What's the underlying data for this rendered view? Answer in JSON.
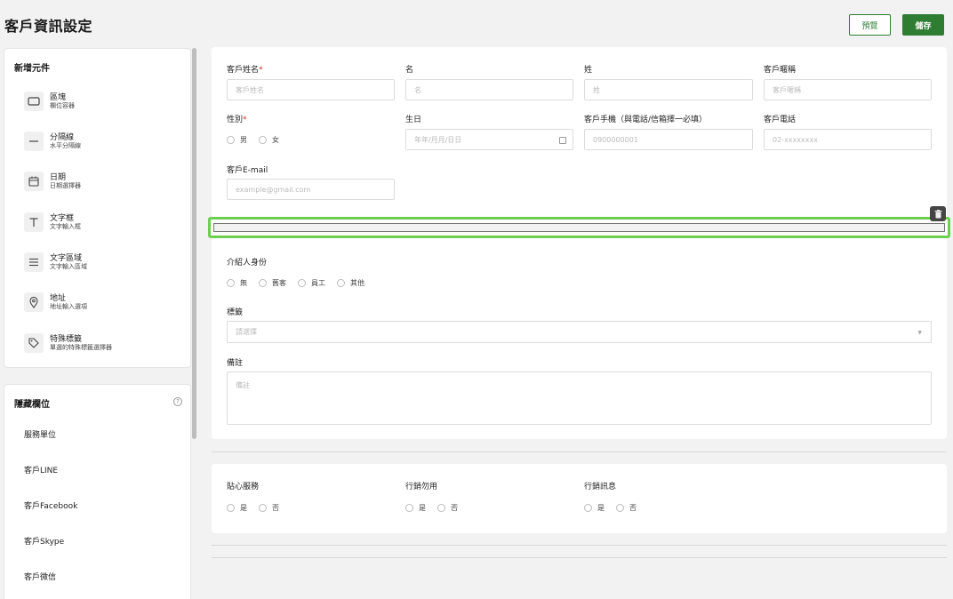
{
  "header": {
    "title": "客戶資訊設定",
    "preview_label": "預覽",
    "save_label": "儲存"
  },
  "components": {
    "title": "新增元件",
    "items": [
      {
        "name": "區塊",
        "desc": "欄位容器",
        "icon": "block-icon"
      },
      {
        "name": "分隔線",
        "desc": "水平分隔線",
        "icon": "divider-icon"
      },
      {
        "name": "日期",
        "desc": "日期選擇器",
        "icon": "calendar-icon"
      },
      {
        "name": "文字框",
        "desc": "文字輸入框",
        "icon": "text-icon"
      },
      {
        "name": "文字區域",
        "desc": "文字輸入區域",
        "icon": "textarea-icon"
      },
      {
        "name": "地址",
        "desc": "地址輸入選項",
        "icon": "location-icon"
      },
      {
        "name": "特殊標籤",
        "desc": "單選的特殊標籤選擇器",
        "icon": "tag-icon"
      }
    ]
  },
  "hidden_fields": {
    "title": "隱藏欄位",
    "items": [
      "服務單位",
      "客戶LINE",
      "客戶Facebook",
      "客戶Skype",
      "客戶微信"
    ]
  },
  "form": {
    "customer_name": {
      "label": "客戶姓名",
      "placeholder": "客戶姓名"
    },
    "first_name": {
      "label": "名",
      "placeholder": "名"
    },
    "last_name": {
      "label": "姓",
      "placeholder": "姓"
    },
    "nickname": {
      "label": "客戶暱稱",
      "placeholder": "客戶暱稱"
    },
    "gender": {
      "label": "性別",
      "options": [
        "男",
        "女"
      ]
    },
    "birthday": {
      "label": "生日",
      "placeholder": "年年/月月/日日"
    },
    "mobile": {
      "label": "客戶手機（與電話/信箱擇一必填）",
      "placeholder": "0900000001"
    },
    "phone": {
      "label": "客戶電話",
      "placeholder": "02-xxxxxxxx"
    },
    "email": {
      "label": "客戶E-mail",
      "placeholder": "example@gmail.com"
    },
    "referrer": {
      "label": "介紹人身份",
      "options": [
        "無",
        "舊客",
        "員工",
        "其他"
      ]
    },
    "tags": {
      "label": "標籤",
      "placeholder": "請選擇"
    },
    "notes": {
      "label": "備註",
      "placeholder": "備註"
    },
    "required_mark": "*"
  },
  "marketing": {
    "care_service": {
      "label": "貼心服務",
      "options": [
        "是",
        "否"
      ]
    },
    "no_marketing": {
      "label": "行銷勿用",
      "options": [
        "是",
        "否"
      ]
    },
    "marketing_msg": {
      "label": "行銷訊息",
      "options": [
        "是",
        "否"
      ]
    }
  },
  "colors": {
    "primary": "#2e7d32",
    "selected": "#6ccf4f",
    "required": "#c62828"
  }
}
